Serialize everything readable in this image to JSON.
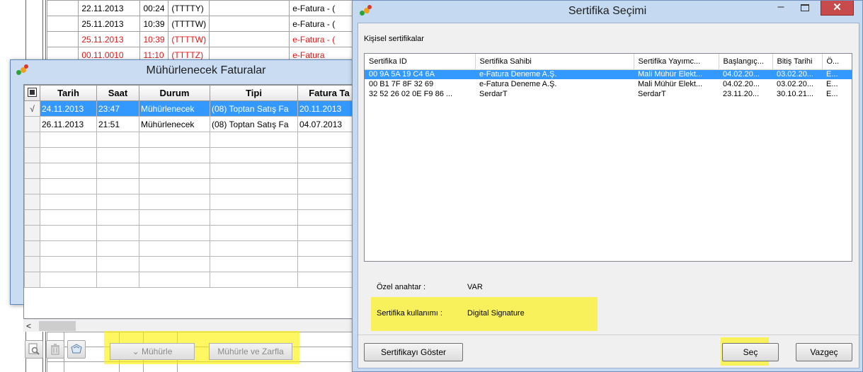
{
  "background": {
    "rows": [
      {
        "date": "22.11.2013",
        "time": "00:24",
        "code": "(TTTTY)",
        "type": "e-Fatura - (",
        "red": false
      },
      {
        "date": "25.11.2013",
        "time": "10:39",
        "code": "(TTTTW)",
        "type": "e-Fatura - (",
        "red": false
      },
      {
        "date": "25.11.2013",
        "time": "10:39",
        "code": "(TTTTW)",
        "type": "e-Fatura - (",
        "red": true
      },
      {
        "date": "00.11.0010",
        "time": "11:10",
        "code": "(TTTTZ)",
        "type": "e-Fatura",
        "red": true
      }
    ]
  },
  "muhur_window": {
    "title": "Mühürlenecek Faturalar",
    "columns": [
      "Tarih",
      "Saat",
      "Durum",
      "Tipi",
      "Fatura Ta"
    ],
    "rows": [
      {
        "mark": "√",
        "date": "24.11.2013",
        "time": "23:47",
        "status": "Mühürlenecek",
        "type": "(08) Toptan Satış Fa",
        "inv_date": "20.11.2013"
      },
      {
        "mark": "",
        "date": "26.11.2013",
        "time": "21:51",
        "status": "Mühürlenecek",
        "type": "(08) Toptan Satış Fa",
        "inv_date": "04.07.2013"
      }
    ],
    "scroll_left_glyph": "<",
    "buttons": {
      "seal": "Mühürle",
      "seal_glyph": "⌄",
      "seal_and_envelope": "Mühürle ve Zarfla"
    },
    "icons": [
      "preview-icon",
      "trash-icon",
      "stamp-icon"
    ]
  },
  "cert_window": {
    "title": "Sertifika Seçimi",
    "controls": {
      "minimize": "–",
      "close": "✕"
    },
    "group_label": "Kişisel sertifikalar",
    "columns": [
      "Sertifika ID",
      "Sertifika Sahibi",
      "Sertifika Yayımc...",
      "Başlangıç...",
      "Bitiş Tarihi",
      "Ö..."
    ],
    "rows": [
      {
        "id": "00 9A 5A 19 C4 6A",
        "owner": "e-Fatura Deneme A.Ş.",
        "issuer": "Mali Mühür Elekt...",
        "start": "04.02.20...",
        "end": "03.02.20...",
        "other": "E..."
      },
      {
        "id": "00 B1 7F 8F 32 69",
        "owner": "e-Fatura Deneme A.Ş.",
        "issuer": "Mali Mühür Elekt...",
        "start": "04.02.20...",
        "end": "03.02.20...",
        "other": "E..."
      },
      {
        "id": "32 52 26 02 0E F9 86 ...",
        "owner": "SerdarT",
        "issuer": "SerdarT",
        "start": "23.11.20...",
        "end": "30.10.21...",
        "other": "E..."
      }
    ],
    "private_key_label": "Özel anahtar :",
    "private_key_value": "VAR",
    "usage_label": "Sertifika kullanımı :",
    "usage_value": "Digital Signature",
    "buttons": {
      "show_cert": "Sertifikayı Göster",
      "select": "Seç",
      "cancel": "Vazgeç"
    }
  },
  "colors": {
    "selection": "#3399ff",
    "highlight": "#fff200",
    "red_text": "#e01818",
    "close_button": "#c74b4b",
    "window_frame": "#c5d9f0"
  }
}
